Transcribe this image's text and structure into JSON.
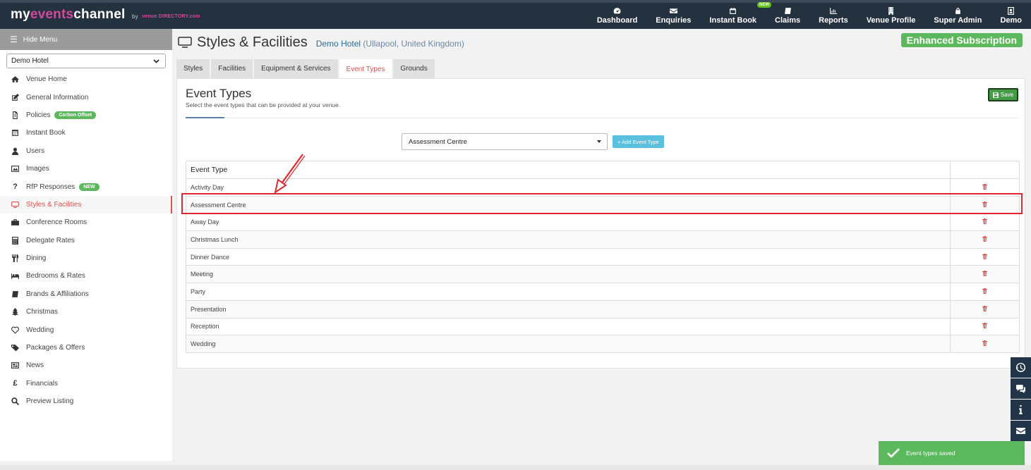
{
  "brand": {
    "name_pre": "my",
    "name_ev": "events",
    "name_post": "channel",
    "by": "by",
    "dir": "venue DIRECTORY.com"
  },
  "nav": [
    {
      "label": "Dashboard",
      "icon": "dashboard-icon"
    },
    {
      "label": "Enquiries",
      "icon": "envelope-icon"
    },
    {
      "label": "Instant Book",
      "icon": "calendar-icon",
      "badge": "NEW"
    },
    {
      "label": "Claims",
      "icon": "book-icon"
    },
    {
      "label": "Reports",
      "icon": "bar-chart-icon"
    },
    {
      "label": "Venue Profile",
      "icon": "building-icon"
    },
    {
      "label": "Super Admin",
      "icon": "lock-icon"
    },
    {
      "label": "Demo",
      "icon": "user-icon"
    }
  ],
  "sidebar": {
    "hide_menu": "Hide Menu",
    "venue": "Demo Hotel",
    "items": [
      {
        "label": "Venue Home",
        "icon": "home-icon"
      },
      {
        "label": "General Information",
        "icon": "edit-icon"
      },
      {
        "label": "Policies",
        "icon": "document-icon",
        "badge": "Carbon Offset"
      },
      {
        "label": "Instant Book",
        "icon": "calendar-icon"
      },
      {
        "label": "Users",
        "icon": "user-icon"
      },
      {
        "label": "Images",
        "icon": "image-icon"
      },
      {
        "label": "RfP Responses",
        "icon": "question-icon",
        "badge": "NEW"
      },
      {
        "label": "Styles & Facilities",
        "icon": "monitor-icon",
        "active": true
      },
      {
        "label": "Conference Rooms",
        "icon": "briefcase-icon"
      },
      {
        "label": "Delegate Rates",
        "icon": "calculator-icon"
      },
      {
        "label": "Dining",
        "icon": "cutlery-icon"
      },
      {
        "label": "Bedrooms & Rates",
        "icon": "bed-icon"
      },
      {
        "label": "Brands & Affiliations",
        "icon": "book-icon"
      },
      {
        "label": "Christmas",
        "icon": "tree-icon"
      },
      {
        "label": "Wedding",
        "icon": "heart-icon"
      },
      {
        "label": "Packages & Offers",
        "icon": "tag-icon"
      },
      {
        "label": "News",
        "icon": "newspaper-icon"
      },
      {
        "label": "Financials",
        "icon": "pound-icon"
      },
      {
        "label": "Preview Listing",
        "icon": "search-icon"
      }
    ]
  },
  "header": {
    "title": "Styles & Facilities",
    "venue": "Demo Hotel",
    "location": "(Ullapool, United Kingdom)",
    "subscription": "Enhanced Subscription"
  },
  "tabs": [
    {
      "label": "Styles"
    },
    {
      "label": "Facilities"
    },
    {
      "label": "Equipment & Services"
    },
    {
      "label": "Event Types",
      "active": true
    },
    {
      "label": "Grounds"
    }
  ],
  "section": {
    "title": "Event Types",
    "description": "Select the event types that can be provided at your venue.",
    "save_label": "Save",
    "select_value": "Assessment Centre",
    "add_label": "+ Add Event Type"
  },
  "table": {
    "header": "Event Type",
    "rows": [
      "Activity Day",
      "Assessment Centre",
      "Away Day",
      "Christmas Lunch",
      "Dinner Dance",
      "Meeting",
      "Party",
      "Presentation",
      "Reception",
      "Wedding"
    ]
  },
  "side_tools": [
    {
      "icon": "history-icon"
    },
    {
      "icon": "chat-icon"
    },
    {
      "icon": "info-icon"
    },
    {
      "icon": "envelope-icon"
    }
  ],
  "toast": {
    "message": "Event types saved"
  },
  "colors": {
    "topbar": "#24313f",
    "accent_red": "#d9534f",
    "green": "#5cb85c",
    "info_blue": "#5bc0de"
  }
}
